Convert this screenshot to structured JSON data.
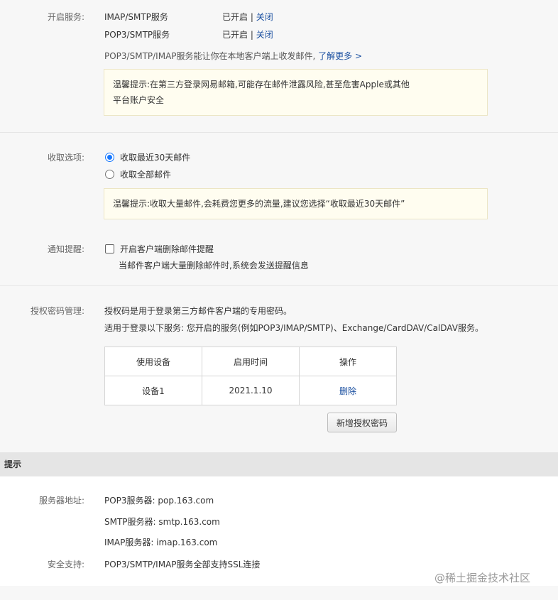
{
  "service": {
    "label": "开启服务:",
    "items": [
      {
        "name": "IMAP/SMTP服务",
        "status": "已开启",
        "sep": "|",
        "action": "关闭"
      },
      {
        "name": "POP3/SMTP服务",
        "status": "已开启",
        "sep": "|",
        "action": "关闭"
      }
    ],
    "desc": "POP3/SMTP/IMAP服务能让你在本地客户端上收发邮件,",
    "learn_more": "了解更多 >",
    "notice_line1": "温馨提示:在第三方登录网易邮箱,可能存在邮件泄露风险,甚至危害Apple或其他",
    "notice_line2": "平台账户安全"
  },
  "fetch": {
    "label": "收取选项:",
    "options": [
      {
        "label": "收取最近30天邮件",
        "selected": true
      },
      {
        "label": "收取全部邮件",
        "selected": false
      }
    ],
    "notice": "温馨提示:收取大量邮件,会耗费您更多的流量,建议您选择“收取最近30天邮件”"
  },
  "notify": {
    "label": "通知提醒:",
    "checkbox_label": "开启客户端删除邮件提醒",
    "checked": false,
    "sub": "当邮件客户端大量删除邮件时,系统会发送提醒信息"
  },
  "auth": {
    "label": "授权密码管理:",
    "line1": "授权码是用于登录第三方邮件客户端的专用密码。",
    "line2": "适用于登录以下服务: 您开启的服务(例如POP3/IMAP/SMTP)、Exchange/CardDAV/CalDAV服务。",
    "table_headers": [
      "使用设备",
      "启用时间",
      "操作"
    ],
    "rows": [
      {
        "device": "设备1",
        "date": "2021.1.10",
        "action": "删除"
      }
    ],
    "add_button": "新增授权密码"
  },
  "tips": {
    "title": "提示",
    "server_label": "服务器地址:",
    "servers": [
      "POP3服务器: pop.163.com",
      "SMTP服务器: smtp.163.com",
      "IMAP服务器: imap.163.com"
    ],
    "security_label": "安全支持:",
    "security_text": "POP3/SMTP/IMAP服务全部支持SSL连接"
  },
  "watermark": "@稀土掘金技术社区",
  "colors": {
    "link": "#1a4fa0",
    "radio_active": "#1677ff",
    "notice_bg": "#fffdf0"
  }
}
